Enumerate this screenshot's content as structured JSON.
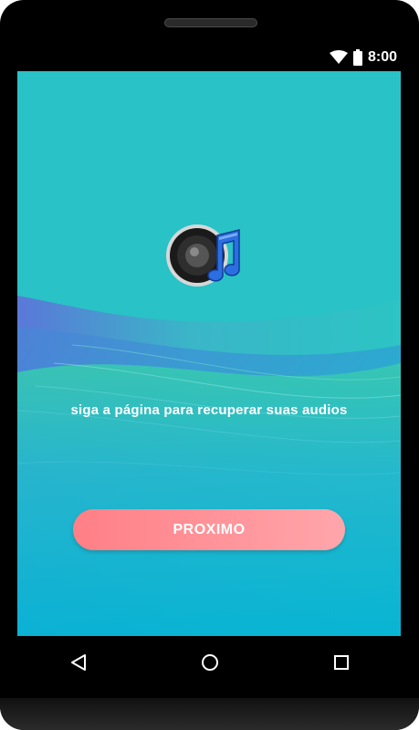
{
  "status_bar": {
    "time": "8:00",
    "icons": [
      "wifi-icon",
      "battery-icon"
    ]
  },
  "app": {
    "icon": "speaker-music-icon",
    "message": "siga a página para recuperar suas audios",
    "next_button_label": "PROXIMO"
  },
  "navigation": {
    "buttons": [
      "back-triangle-icon",
      "home-circle-icon",
      "recents-square-icon"
    ]
  },
  "colors": {
    "screen_background": "#29c2c6",
    "button_gradient_start": "#ff7f86",
    "button_gradient_end": "#ffa6ab",
    "device_frame": "#000000"
  }
}
